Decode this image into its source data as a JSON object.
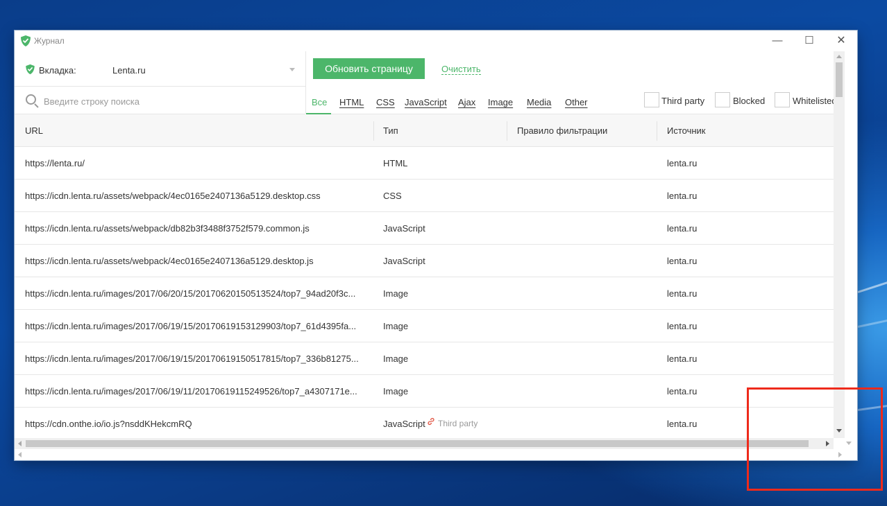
{
  "window": {
    "title": "Журнал",
    "minimize": "—",
    "maximize": "☐",
    "close": "✕"
  },
  "tab_selector": {
    "label": "Вкладка:",
    "value": "Lenta.ru"
  },
  "toolbar": {
    "refresh_label": "Обновить страницу",
    "clear_label": "Очистить"
  },
  "search": {
    "placeholder": "Введите строку поиска"
  },
  "filter_tabs": [
    {
      "label": "Все",
      "active": true
    },
    {
      "label": "HTML"
    },
    {
      "label": "CSS"
    },
    {
      "label": "JavaScript"
    },
    {
      "label": "Ajax"
    },
    {
      "label": "Image"
    },
    {
      "label": "Media"
    },
    {
      "label": "Other"
    }
  ],
  "checkboxes": [
    {
      "label": "Third party",
      "checked": false
    },
    {
      "label": "Blocked",
      "checked": false
    },
    {
      "label": "Whitelisted",
      "checked": false
    }
  ],
  "table": {
    "columns": [
      "URL",
      "Тип",
      "Правило фильтрации",
      "Источник"
    ],
    "rows": [
      {
        "url": "https://lenta.ru/",
        "type": "HTML",
        "rule": "",
        "source": "lenta.ru"
      },
      {
        "url": "https://icdn.lenta.ru/assets/webpack/4ec0165e2407136a5129.desktop.css",
        "type": "CSS",
        "rule": "",
        "source": "lenta.ru"
      },
      {
        "url": "https://icdn.lenta.ru/assets/webpack/db82b3f3488f3752f579.common.js",
        "type": "JavaScript",
        "rule": "",
        "source": "lenta.ru"
      },
      {
        "url": "https://icdn.lenta.ru/assets/webpack/4ec0165e2407136a5129.desktop.js",
        "type": "JavaScript",
        "rule": "",
        "source": "lenta.ru"
      },
      {
        "url": "https://icdn.lenta.ru/images/2017/06/20/15/20170620150513524/top7_94ad20f3c...",
        "type": "Image",
        "rule": "",
        "source": "lenta.ru"
      },
      {
        "url": "https://icdn.lenta.ru/images/2017/06/19/15/20170619153129903/top7_61d4395fa...",
        "type": "Image",
        "rule": "",
        "source": "lenta.ru"
      },
      {
        "url": "https://icdn.lenta.ru/images/2017/06/19/15/20170619150517815/top7_336b81275...",
        "type": "Image",
        "rule": "",
        "source": "lenta.ru"
      },
      {
        "url": "https://icdn.lenta.ru/images/2017/06/19/11/20170619115249526/top7_a4307171e...",
        "type": "Image",
        "rule": "",
        "source": "lenta.ru"
      },
      {
        "url": "https://cdn.onthe.io/io.js?nsddKHekcmRQ",
        "type": "JavaScript",
        "third_party": "Third party",
        "rule": "",
        "source": "lenta.ru"
      }
    ]
  },
  "colors": {
    "accent": "#4cb66a",
    "highlight_border": "#ee2a1b",
    "third_party_icon": "#e25b4a"
  },
  "icons": {
    "title": "shield-check-icon",
    "tab": "shield-check-icon",
    "search": "magnifier-icon",
    "third_party": "link-icon"
  }
}
